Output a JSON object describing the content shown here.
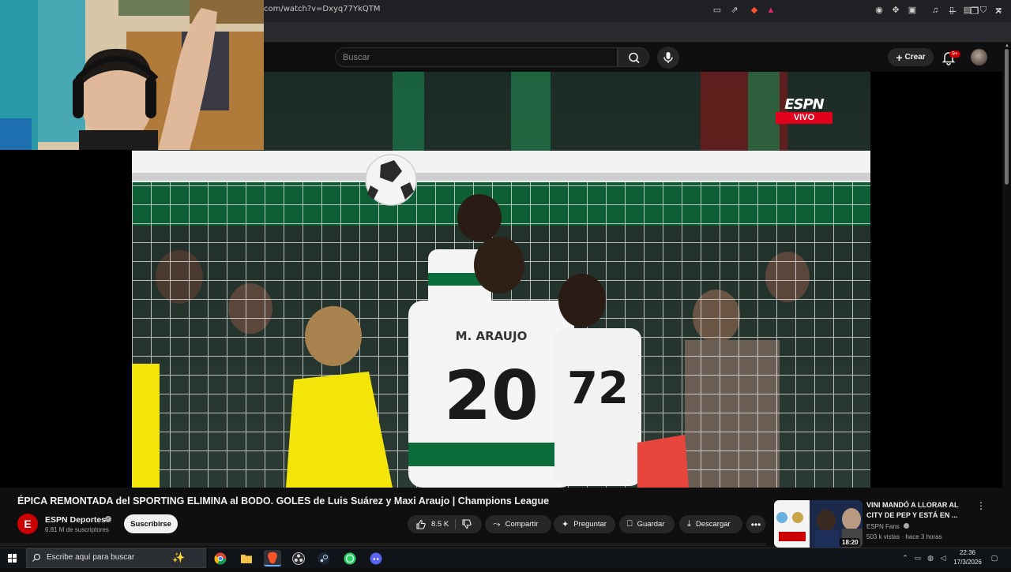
{
  "browser": {
    "url": "com/watch?v=Dxyq77YkQTM",
    "window_controls": [
      "minimize",
      "restore",
      "close"
    ]
  },
  "header": {
    "search_placeholder": "Buscar",
    "create_label": "Crear",
    "notifications_badge": "9+"
  },
  "video": {
    "broadcaster_logo": "ESPN",
    "broadcaster_live": "VIVO",
    "title": "ÉPICA REMONTADA del SPORTING ELIMINA al BODO. GOLES de Luis Suárez y Maxi Araujo | Champions League",
    "channel": {
      "initial": "E",
      "name": "ESPN Deportes",
      "subscribers": "6.81 M de suscriptores",
      "subscribe_label": "Suscribirse"
    },
    "actions": {
      "likes": "8.5 K",
      "share": "Compartir",
      "ask": "Preguntar",
      "save": "Guardar",
      "download": "Descargar"
    }
  },
  "recommended": {
    "title": "VINI MANDÓ A LLORAR AL CITY DE PEP Y ESTÁ EN ...",
    "channel": "ESPN Fans",
    "meta": "503 k vistas · hace 3 horas",
    "duration": "18:20"
  },
  "taskbar": {
    "search_placeholder": "Escribe aquí para buscar",
    "time": "22:36",
    "date": "17/3/2026"
  },
  "colors": {
    "youtube_bg": "#0f0f0f",
    "brand_red": "#cc0000",
    "espn_red": "#e0001b",
    "pitch_green": "#0b6b3a"
  }
}
